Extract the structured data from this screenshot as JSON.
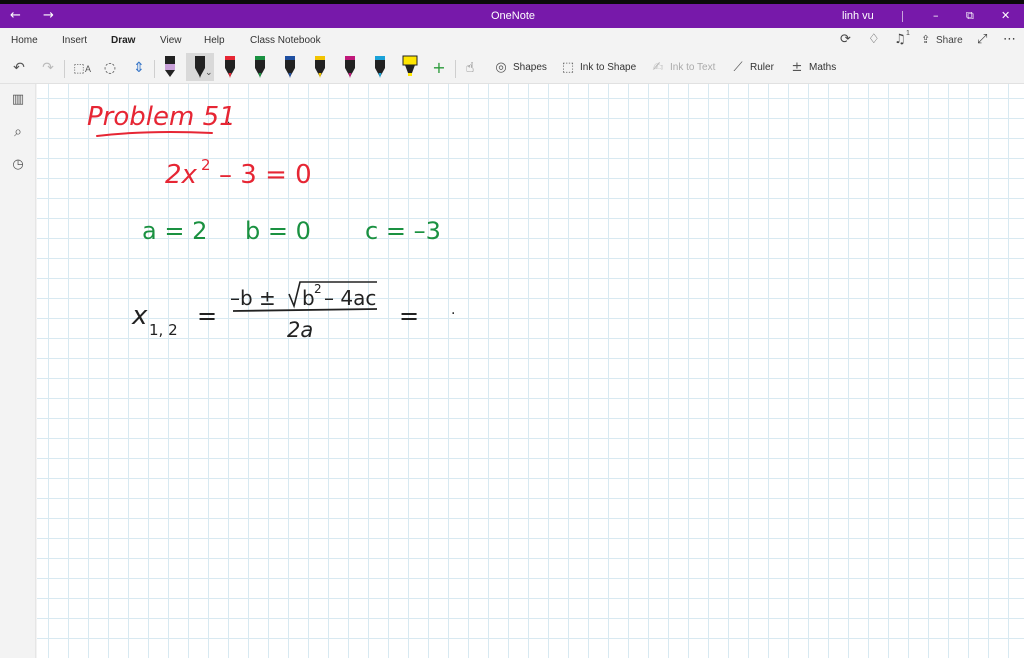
{
  "app": {
    "nav_back": "←",
    "nav_forward": "→",
    "title": "OneNote",
    "user": "linh vu",
    "minimize": "–",
    "restore": "⧉",
    "close": "✕"
  },
  "tabs": [
    {
      "label": "Home"
    },
    {
      "label": "Insert"
    },
    {
      "label": "Draw"
    },
    {
      "label": "View"
    },
    {
      "label": "Help"
    },
    {
      "label": "Class Notebook"
    }
  ],
  "active_tab": "Draw",
  "ribbon_right": {
    "sync": "⟳",
    "ideas": "♢",
    "notifications": "♫",
    "notifications_count": "1",
    "share": "Share",
    "expand": "⤢",
    "more": "⋯"
  },
  "toolbar": {
    "undo": "↶",
    "redo": "↷",
    "lasso_select": "⬚",
    "lasso_text": "A",
    "eraser": "◌",
    "add_space": "⇕",
    "pens": [
      {
        "color": "#c8a0d8",
        "kind": "eraser-pen"
      },
      {
        "color": "#222222",
        "kind": "pen"
      },
      {
        "color": "#e62634",
        "kind": "pen"
      },
      {
        "color": "#1a9141",
        "kind": "pen"
      },
      {
        "color": "#1f4fa0",
        "kind": "pen"
      },
      {
        "color": "#f2c400",
        "kind": "pen"
      },
      {
        "color": "#c0187a",
        "kind": "pen"
      },
      {
        "color": "#1aa2d8",
        "kind": "pen"
      },
      {
        "color": "#ffe600",
        "kind": "highlighter"
      }
    ],
    "add_pen": "+",
    "touch_draw": "☝",
    "shapes": "Shapes",
    "ink_to_shape": "Ink to Shape",
    "ink_to_text": "Ink to Text",
    "ruler": "Ruler",
    "maths": "Maths"
  },
  "rail": {
    "notebooks": "▥",
    "search": "⌕",
    "recent": "◷"
  },
  "colors": {
    "title_bar": "#7719aa",
    "ink_red": "#e62634",
    "ink_green": "#1a9141",
    "ink_black": "#222222",
    "grid": "#d8e9f1"
  },
  "notes": {
    "heading": "Problem 51",
    "equation": {
      "lhs": "2x",
      "exp": "2",
      "rhs": "– 3 = 0"
    },
    "coefficients": {
      "a": "a = 2",
      "b": "b = 0",
      "c": "c = –3"
    },
    "formula": {
      "var": "x",
      "sub": "1, 2",
      "eq": "=",
      "numerator_left": "–b ± ",
      "radicand_base": "b",
      "radicand_exp": "2",
      "radicand_rest": "– 4ac",
      "denominator": "2a",
      "trail": "=",
      "dot": "·"
    }
  }
}
